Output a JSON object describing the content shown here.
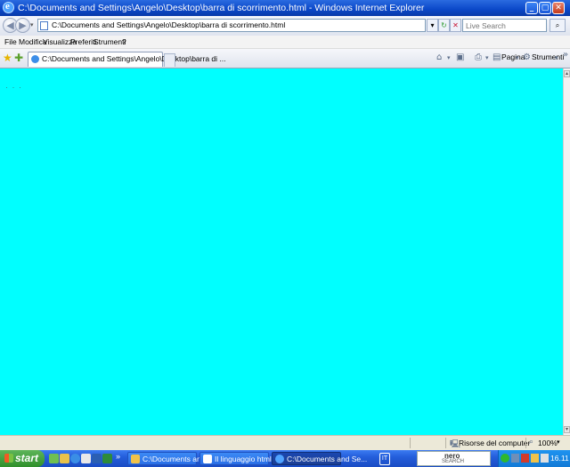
{
  "window": {
    "title": "C:\\Documents and Settings\\Angelo\\Desktop\\barra di scorrimento.html - Windows Internet Explorer",
    "app_icon": "ie-icon"
  },
  "addressbar": {
    "url": "C:\\Documents and Settings\\Angelo\\Desktop\\barra di scorrimento.html",
    "search_placeholder": "Live Search"
  },
  "menu": {
    "items": [
      "File",
      "Modifica",
      "Visualizza",
      "Preferiti",
      "Strumenti",
      "?"
    ]
  },
  "tabs": {
    "active_label": "C:\\Documents and Settings\\Angelo\\Desktop\\barra di ..."
  },
  "commandbar": {
    "page_label": "Pagina",
    "tools_label": "Strumenti"
  },
  "content": {
    "background": "#00ffff",
    "dots": "·  ·  ·"
  },
  "statusbar": {
    "zone": "Risorse del computer",
    "zoom": "100%"
  },
  "taskbar": {
    "start_label": "start",
    "tasks": [
      {
        "label": "C:\\Documents and Se..."
      },
      {
        "label": "Il linguaggio html 1 - ..."
      },
      {
        "label": "C:\\Documents and Se..."
      }
    ],
    "nero_title": "nero",
    "nero_subtitle": "SEARCH",
    "clock": "16.11"
  }
}
